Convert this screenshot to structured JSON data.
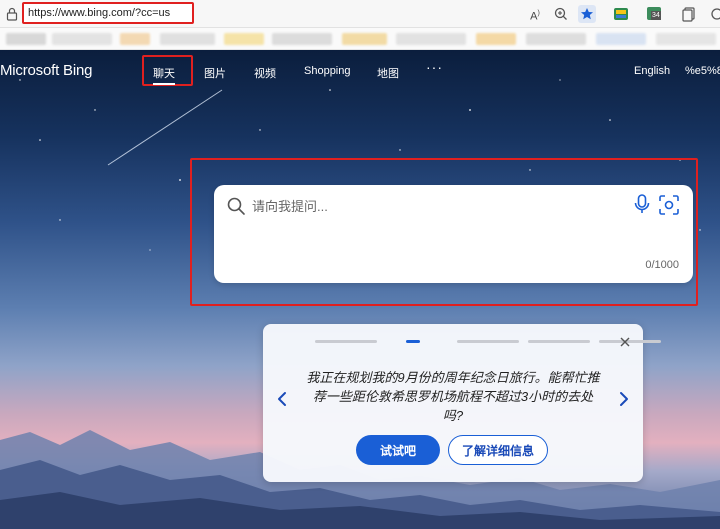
{
  "browser": {
    "url": "https://www.bing.com/?cc=us",
    "icons": [
      "read-aloud-icon",
      "zoom-icon",
      "favorite-star-icon",
      "extension-icon",
      "badge-extension-icon",
      "copy-icon",
      "more-icon"
    ],
    "badge_count": "34"
  },
  "header": {
    "logo": "Microsoft Bing",
    "nav": {
      "chat": "聊天",
      "images": "图片",
      "videos": "视频",
      "shopping": "Shopping",
      "maps": "地图",
      "more": "···"
    },
    "language": "English",
    "user": "%e5%8"
  },
  "search": {
    "placeholder": "请向我提问...",
    "value": "",
    "char_count": "0/1000"
  },
  "suggestion": {
    "text": "我正在规划我的9月份的周年纪念日旅行。能帮忙推荐一些距伦敦希思罗机场航程不超过3小时的去处吗?",
    "try_label": "试试吧",
    "learn_label": "了解详细信息",
    "carousel_total": 5,
    "carousel_active": 2
  },
  "colors": {
    "accent": "#1a5fd6",
    "highlight_red": "#e0201f"
  }
}
